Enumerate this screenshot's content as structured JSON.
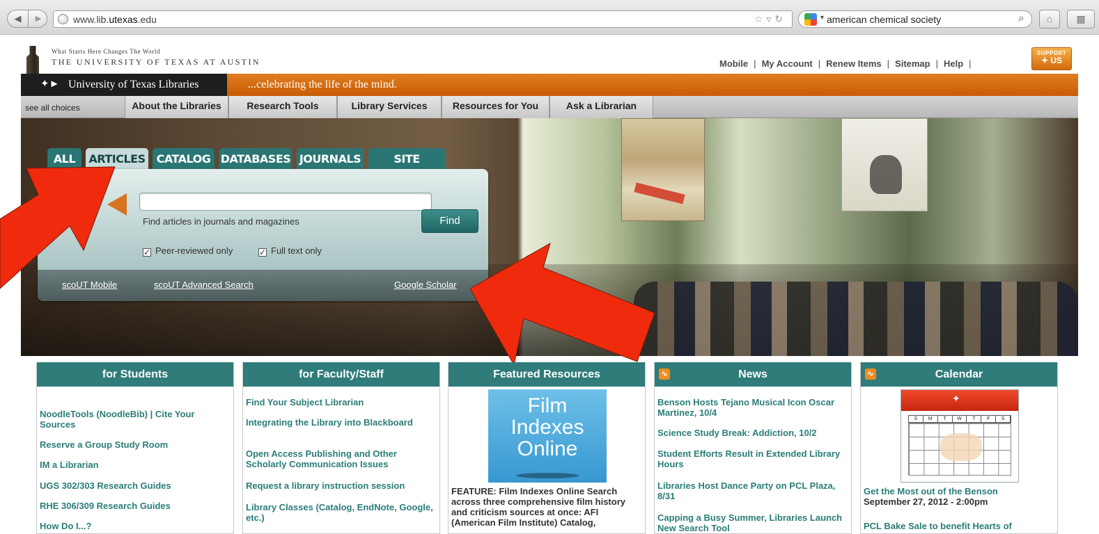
{
  "browser": {
    "url_prefix": "www.lib.",
    "url_domain": "utexas",
    "url_suffix": ".edu",
    "search_query": "american chemical society"
  },
  "header": {
    "tagline": "What Starts Here Changes The World",
    "university": "THE UNIVERSITY OF TEXAS AT AUSTIN",
    "util_links": [
      "Mobile",
      "My Account",
      "Renew Items",
      "Sitemap",
      "Help"
    ],
    "support_top": "SUPPORT",
    "support_bottom": "US"
  },
  "banner": {
    "library_name": "University of Texas Libraries",
    "slogan": "...celebrating the life of the mind."
  },
  "menu": {
    "see_all": "see all choices",
    "items": [
      "About the Libraries",
      "Research Tools",
      "Library Services",
      "Resources for You",
      "Ask a Librarian"
    ]
  },
  "search": {
    "tabs": [
      "ALL",
      "ARTICLES",
      "CATALOG",
      "DATABASES",
      "JOURNALS",
      "SITE SEARCH"
    ],
    "active_tab": "ARTICLES",
    "input_value": "",
    "hint": "Find articles in journals and magazines",
    "find_label": "Find",
    "check_peer": "Peer-reviewed only",
    "check_fulltext": "Full text only",
    "footer_links": [
      "scoUT Mobile",
      "scoUT Advanced Search",
      "Google Scholar"
    ]
  },
  "columns": {
    "students": {
      "title": "for Students",
      "links": [
        "NoodleTools (NoodleBib) | Cite Your Sources",
        "Reserve a Group Study Room",
        "IM a Librarian",
        "UGS 302/303 Research Guides",
        "RHE 306/309 Research Guides",
        "How Do I...?"
      ]
    },
    "faculty": {
      "title": "for Faculty/Staff",
      "links": [
        "Find Your Subject Librarian",
        "Integrating the Library into Blackboard",
        "Open Access Publishing and Other Scholarly Communication Issues",
        "Request a library instruction session",
        "Library Classes (Catalog, EndNote, Google, etc.)"
      ]
    },
    "featured": {
      "title": "Featured Resources",
      "logo_lines": [
        "Film",
        "Indexes",
        "Online"
      ],
      "text": "FEATURE: Film Indexes Online Search across three comprehensive film history and criticism sources at once: AFI (American Film Institute) Catalog,"
    },
    "news": {
      "title": "News",
      "links": [
        "Benson Hosts Tejano Musical Icon Oscar Martinez, 10/4",
        "Science Study Break: Addiction, 10/2",
        "Student Efforts Result in Extended Library Hours",
        "Libraries Host Dance Party on PCL Plaza, 8/31",
        "Capping a Busy Summer, Libraries Launch New Search Tool"
      ]
    },
    "calendar": {
      "title": "Calendar",
      "days": [
        "S",
        "M",
        "T",
        "W",
        "T",
        "F",
        "S"
      ],
      "event1": "Get the Most out of the Benson",
      "event1_date": "September 27, 2012 - 2:00pm",
      "event2": "PCL Bake Sale to benefit Hearts of"
    }
  },
  "colors": {
    "teal": "#2f7c7a",
    "orange": "#d46a0c",
    "annotation_red": "#f02a0c"
  }
}
